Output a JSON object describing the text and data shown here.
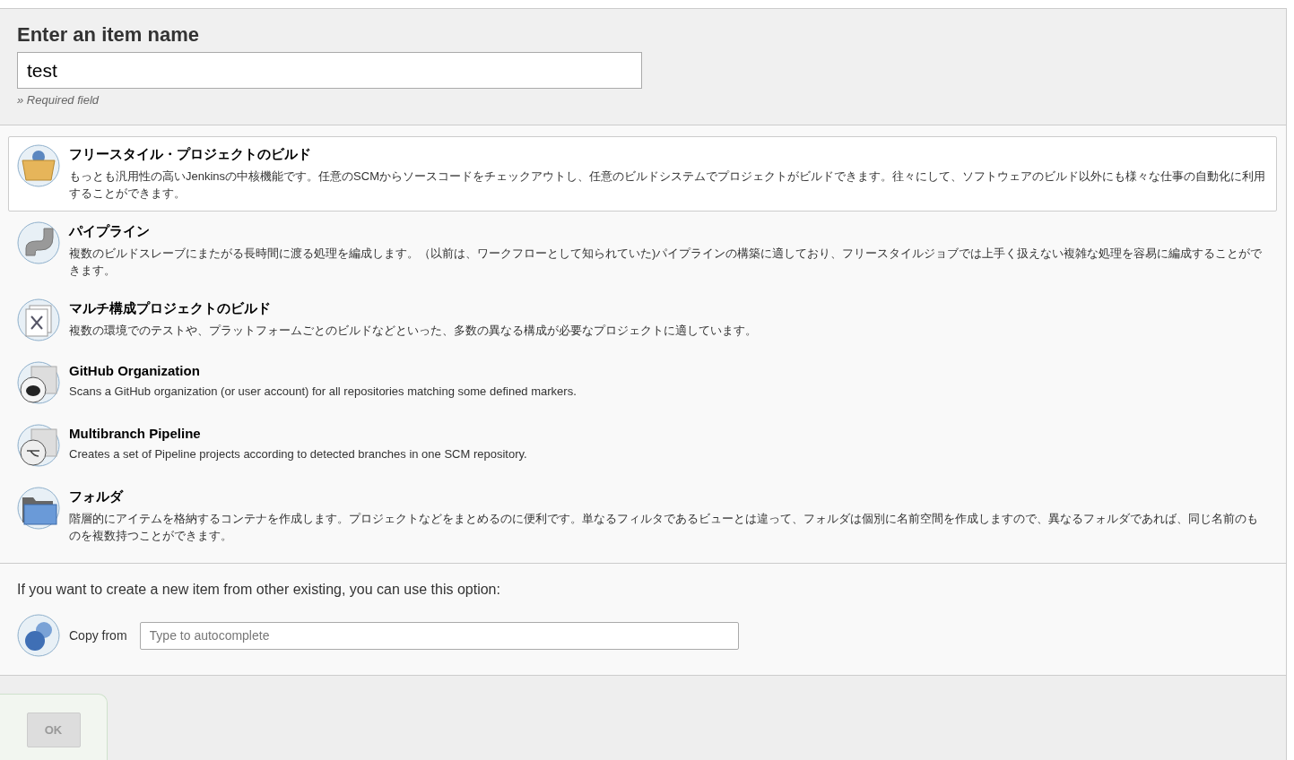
{
  "name_section": {
    "title": "Enter an item name",
    "value": "test",
    "hint": "» Required field"
  },
  "items": [
    {
      "kind": "box",
      "title": "フリースタイル・プロジェクトのビルド",
      "description": "もっとも汎用性の高いJenkinsの中核機能です。任意のSCMからソースコードをチェックアウトし、任意のビルドシステムでプロジェクトがビルドできます。往々にして、ソフトウェアのビルド以外にも様々な仕事の自動化に利用することができます。",
      "selected": true
    },
    {
      "kind": "pipe",
      "title": "パイプライン",
      "description": "複数のビルドスレーブにまたがる長時間に渡る処理を編成します。（以前は、ワークフローとして知られていた)パイプラインの構築に適しており、フリースタイルジョブでは上手く扱えない複雑な処理を容易に編成することができます。",
      "selected": false
    },
    {
      "kind": "multi",
      "title": "マルチ構成プロジェクトのビルド",
      "description": "複数の環境でのテストや、プラットフォームごとのビルドなどといった、多数の異なる構成が必要なプロジェクトに適しています。",
      "selected": false
    },
    {
      "kind": "github",
      "title": "GitHub Organization",
      "description": "Scans a GitHub organization (or user account) for all repositories matching some defined markers.",
      "selected": false
    },
    {
      "kind": "branch",
      "title": "Multibranch Pipeline",
      "description": "Creates a set of Pipeline projects according to detected branches in one SCM repository.",
      "selected": false
    },
    {
      "kind": "folder",
      "title": "フォルダ",
      "description": "階層的にアイテムを格納するコンテナを作成します。プロジェクトなどをまとめるのに便利です。単なるフィルタであるビューとは違って、フォルダは個別に名前空間を作成しますので、異なるフォルダであれば、同じ名前のものを複数持つことができます。",
      "selected": false
    }
  ],
  "copy_section": {
    "text": "If you want to create a new item from other existing, you can use this option:",
    "label": "Copy from",
    "placeholder": "Type to autocomplete"
  },
  "ok_button": {
    "label": "OK",
    "disabled": true
  }
}
